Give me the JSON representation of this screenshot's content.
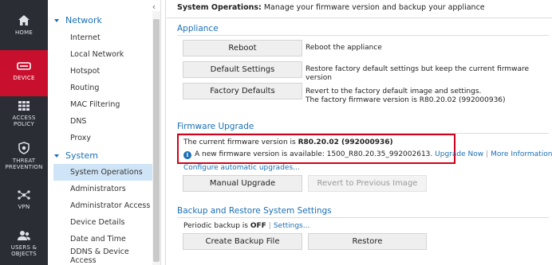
{
  "leftnav": {
    "items": [
      {
        "label": "HOME",
        "icon": "home-icon"
      },
      {
        "label": "DEVICE",
        "icon": "device-icon"
      },
      {
        "label": "ACCESS POLICY",
        "icon": "grid-icon"
      },
      {
        "label": "THREAT PREVENTION",
        "icon": "shield-icon"
      },
      {
        "label": "VPN",
        "icon": "network-icon"
      },
      {
        "label": "USERS & OBJECTS",
        "icon": "users-icon"
      }
    ]
  },
  "sidebar": {
    "collapse_glyph": "‹",
    "groups": [
      {
        "label": "Network",
        "items": [
          "Internet",
          "Local Network",
          "Hotspot",
          "Routing",
          "MAC Filtering",
          "DNS",
          "Proxy"
        ]
      },
      {
        "label": "System",
        "items": [
          "System Operations",
          "Administrators",
          "Administrator Access",
          "Device Details",
          "Date and Time",
          "DDNS & Device Access"
        ]
      }
    ],
    "selected": "System Operations"
  },
  "main": {
    "header_bold": "System Operations:",
    "header_text": " Manage your firmware version and backup your appliance",
    "appliance": {
      "title": "Appliance",
      "reboot_label": "Reboot",
      "reboot_desc": "Reboot the appliance",
      "default_label": "Default Settings",
      "default_desc": "Restore factory default settings but keep the current firmware version",
      "factory_label": "Factory Defaults",
      "factory_desc_1": "Revert to the factory default image and settings.",
      "factory_desc_2": "The factory firmware version is R80.20.02 (992000936)"
    },
    "firmware": {
      "title": "Firmware Upgrade",
      "current_prefix": "The current firmware version is ",
      "current_version": "R80.20.02 (992000936)",
      "new_text": "A new firmware version is available: 1500_R80.20.35_992002613.",
      "upgrade_now": "Upgrade Now",
      "more_info": "More Information",
      "configure_link": "Configure automatic upgrades...",
      "manual_label": "Manual Upgrade",
      "revert_label": "Revert to Previous Image"
    },
    "backup": {
      "title": "Backup and Restore System Settings",
      "periodic_prefix": "Periodic backup is ",
      "periodic_state": "OFF",
      "separator": "|",
      "settings_link": "Settings...",
      "create_label": "Create Backup File",
      "restore_label": "Restore"
    }
  }
}
